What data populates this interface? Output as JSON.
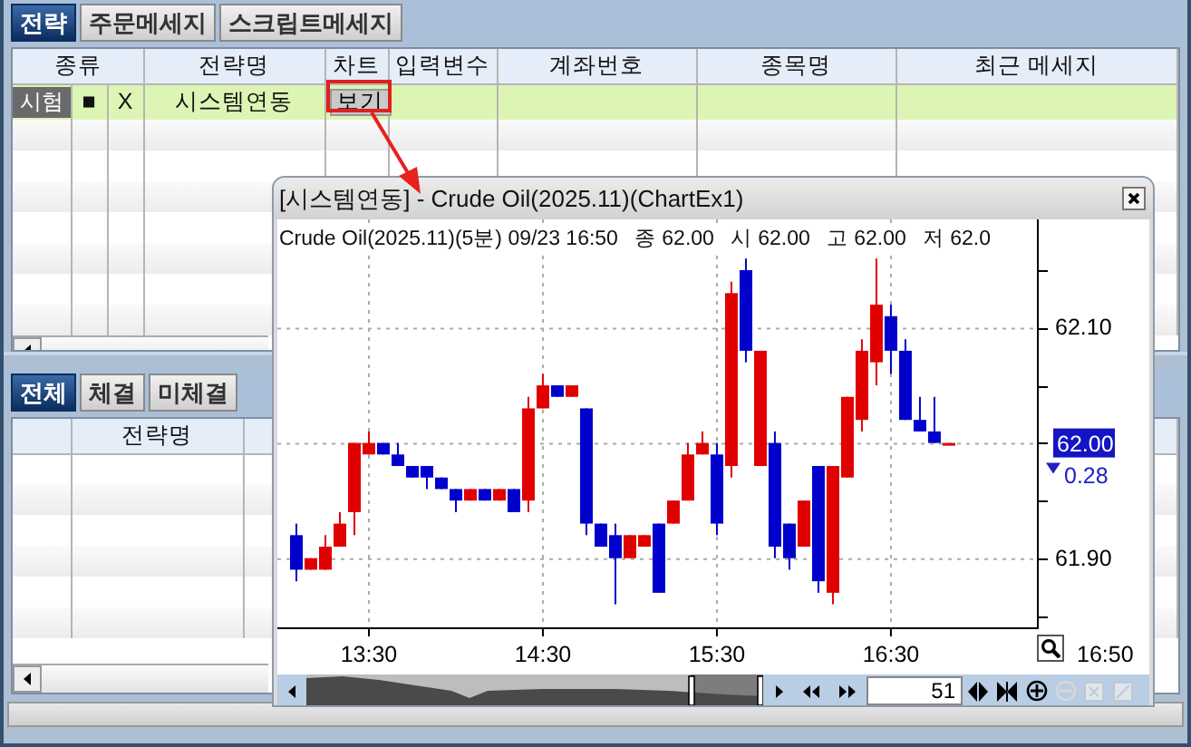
{
  "top_tabs": [
    {
      "label": "전략",
      "selected": true
    },
    {
      "label": "주문메세지",
      "selected": false
    },
    {
      "label": "스크립트메세지",
      "selected": false
    }
  ],
  "strategy_grid": {
    "columns": [
      "종류",
      "전략명",
      "차트",
      "입력변수",
      "계좌번호",
      "종목명",
      "최근 메세지"
    ],
    "rows": [
      {
        "type_label": "시험",
        "mark": "■",
        "flag": "X",
        "strategy": "시스템연동",
        "chart_button": "보기",
        "selected": true
      }
    ]
  },
  "bottom_tabs": [
    {
      "label": "전체",
      "selected": true
    },
    {
      "label": "체결",
      "selected": false
    },
    {
      "label": "미체결",
      "selected": false
    }
  ],
  "order_grid": {
    "columns": [
      "전략명"
    ]
  },
  "chart_window": {
    "title": "[시스템연동] - Crude Oil(2025.11)(ChartEx1)",
    "info": [
      "Crude Oil(2025.11)(5분) 09/23 16:50",
      "종 62.00",
      "시 62.00",
      "고 62.00",
      "저 62.0"
    ],
    "chart_data": {
      "type": "candlestick",
      "x": [
        13.0833,
        13.1667,
        13.25,
        13.3333,
        13.4167,
        13.5,
        13.5833,
        13.6667,
        13.75,
        13.8333,
        13.9167,
        14,
        14.0833,
        14.1667,
        14.25,
        14.3333,
        14.4167,
        14.5,
        14.5833,
        14.6667,
        14.75,
        14.8333,
        14.9167,
        15,
        15.0833,
        15.1667,
        15.25,
        15.3333,
        15.4167,
        15.5,
        15.5833,
        15.6667,
        15.75,
        15.8333,
        15.9167,
        16,
        16.0833,
        16.1667,
        16.25,
        16.3333,
        16.4167,
        16.5,
        16.5833,
        16.6667,
        16.75,
        16.8333
      ],
      "ohlc": [
        [
          61.92,
          61.93,
          61.88,
          61.89
        ],
        [
          61.89,
          61.9,
          61.89,
          61.9
        ],
        [
          61.89,
          61.92,
          61.89,
          61.91
        ],
        [
          61.91,
          61.94,
          61.91,
          61.93
        ],
        [
          61.94,
          62.0,
          61.92,
          62.0
        ],
        [
          61.99,
          62.01,
          61.99,
          62.0
        ],
        [
          62.0,
          62.0,
          61.99,
          61.99
        ],
        [
          61.99,
          62.0,
          61.98,
          61.98
        ],
        [
          61.98,
          61.98,
          61.97,
          61.97
        ],
        [
          61.98,
          61.98,
          61.96,
          61.97
        ],
        [
          61.97,
          61.97,
          61.96,
          61.96
        ],
        [
          61.96,
          61.96,
          61.94,
          61.95
        ],
        [
          61.95,
          61.96,
          61.95,
          61.96
        ],
        [
          61.96,
          61.96,
          61.95,
          61.95
        ],
        [
          61.95,
          61.96,
          61.95,
          61.96
        ],
        [
          61.96,
          61.96,
          61.94,
          61.94
        ],
        [
          61.95,
          62.04,
          61.94,
          62.03
        ],
        [
          62.03,
          62.06,
          62.03,
          62.05
        ],
        [
          62.05,
          62.05,
          62.04,
          62.04
        ],
        [
          62.04,
          62.05,
          62.04,
          62.05
        ],
        [
          62.03,
          62.03,
          61.92,
          61.93
        ],
        [
          61.93,
          61.93,
          61.91,
          61.91
        ],
        [
          61.92,
          61.93,
          61.86,
          61.9
        ],
        [
          61.9,
          61.92,
          61.9,
          61.92
        ],
        [
          61.91,
          61.92,
          61.91,
          61.92
        ],
        [
          61.93,
          61.93,
          61.87,
          61.87
        ],
        [
          61.93,
          61.95,
          61.93,
          61.95
        ],
        [
          61.95,
          62.0,
          61.95,
          61.99
        ],
        [
          61.99,
          62.01,
          61.99,
          62.0
        ],
        [
          61.99,
          62.0,
          61.92,
          61.93
        ],
        [
          61.98,
          62.14,
          61.97,
          62.13
        ],
        [
          62.15,
          62.16,
          62.07,
          62.08
        ],
        [
          61.98,
          62.08,
          61.98,
          62.08
        ],
        [
          62.0,
          62.01,
          61.9,
          61.91
        ],
        [
          61.93,
          61.93,
          61.89,
          61.9
        ],
        [
          61.91,
          61.95,
          61.91,
          61.95
        ],
        [
          61.98,
          61.98,
          61.87,
          61.88
        ],
        [
          61.87,
          61.98,
          61.86,
          61.98
        ],
        [
          61.97,
          62.04,
          61.97,
          62.04
        ],
        [
          62.02,
          62.09,
          62.01,
          62.08
        ],
        [
          62.07,
          62.16,
          62.05,
          62.12
        ],
        [
          62.11,
          62.12,
          62.06,
          62.08
        ],
        [
          62.08,
          62.09,
          62.02,
          62.02
        ],
        [
          62.02,
          62.04,
          62.01,
          62.01
        ],
        [
          62.01,
          62.04,
          62.0,
          62.0
        ],
        [
          62.0,
          62.0,
          62.0,
          62.0
        ]
      ],
      "xticks": [
        {
          "value": 13.5,
          "label": "13:30"
        },
        {
          "value": 14.5,
          "label": "14:30"
        },
        {
          "value": 15.5,
          "label": "15:30"
        },
        {
          "value": 16.5,
          "label": "16:30"
        }
      ],
      "xlim": [
        12.974,
        17.339
      ],
      "ylim": [
        61.84,
        62.194
      ],
      "grid": true,
      "yticks": [
        {
          "value": 62.1,
          "label": "62.10"
        },
        {
          "value": 61.9,
          "label": "61.90"
        }
      ]
    },
    "last_price": "62.00",
    "change": "0.28",
    "falling": true,
    "axis_end_time": "16:50",
    "navigator": {
      "bar_count": "51"
    }
  }
}
